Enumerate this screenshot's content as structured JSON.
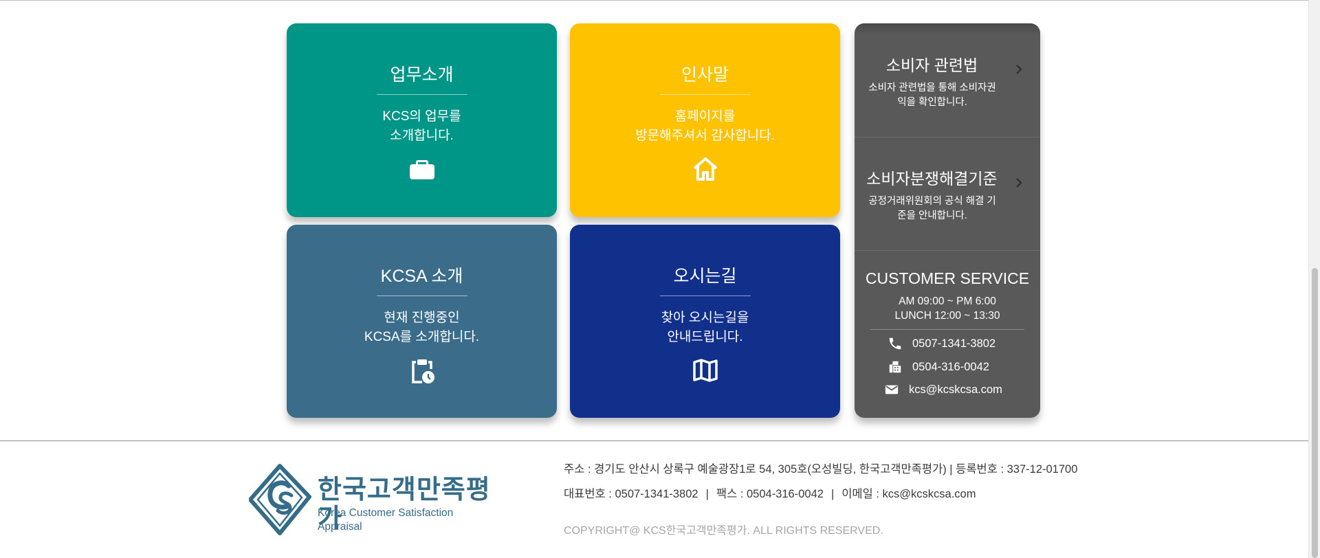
{
  "tiles": {
    "work": {
      "title": "업무소개",
      "desc_line1": "KCS의 업무를",
      "desc_line2": "소개합니다.",
      "icon": "briefcase-icon",
      "color": "#009687"
    },
    "greeting": {
      "title": "인사말",
      "desc_line1": "홈페이지를",
      "desc_line2": "방문해주셔서 감사합니다.",
      "icon": "home-icon",
      "color": "#ffc200"
    },
    "kcsa": {
      "title": "KCSA 소개",
      "desc_line1": "현재 진행중인",
      "desc_line2": "KCSA를 소개합니다.",
      "icon": "clipboard-clock-icon",
      "color": "#3b6d8b"
    },
    "directions": {
      "title": "오시는길",
      "desc_line1": "찾아 오시는길을",
      "desc_line2": "안내드립니다.",
      "icon": "map-icon",
      "color": "#11308c"
    }
  },
  "side": {
    "law": {
      "title": "소비자 관련법",
      "desc": "소비자 관련법을 통해 소비자권익을 확인합니다.",
      "icon": "chevron-right-icon"
    },
    "dispute": {
      "title": "소비자분쟁해결기준",
      "desc": "공정거래위원회의 공식 해결 기준을 안내합니다.",
      "icon": "chevron-right-icon"
    },
    "cs": {
      "title": "CUSTOMER SERVICE",
      "hours": "AM 09:00 ~ PM 6:00",
      "lunch": "LUNCH 12:00 ~ 13:30",
      "phone": "0507-1341-3802",
      "fax": "0504-316-0042",
      "email": "kcs@kcskcsa.com",
      "icons": [
        "phone-icon",
        "fax-icon",
        "mail-icon"
      ]
    },
    "color": "#595959"
  },
  "footer": {
    "logo_ko": "한국고객만족평가",
    "logo_en": "Korea Customer Satisfaction Appraisal",
    "address_line": "주소 : 경기도 안산시 상록구 예술광장1로 54, 305호(오성빌딩, 한국고객만족평가) | 등록번호 : 337-12-01700",
    "contact_main": "대표번호 : 0507-1341-3802",
    "contact_sep": "|",
    "contact_fax": "팩스 :  0504-316-0042",
    "contact_email": "이메일 : kcs@kcskcsa.com",
    "copyright": "COPYRIGHT@ KCS한국고객만족평가. ALL RIGHTS RESERVED.",
    "brand_color": "#356c89"
  }
}
